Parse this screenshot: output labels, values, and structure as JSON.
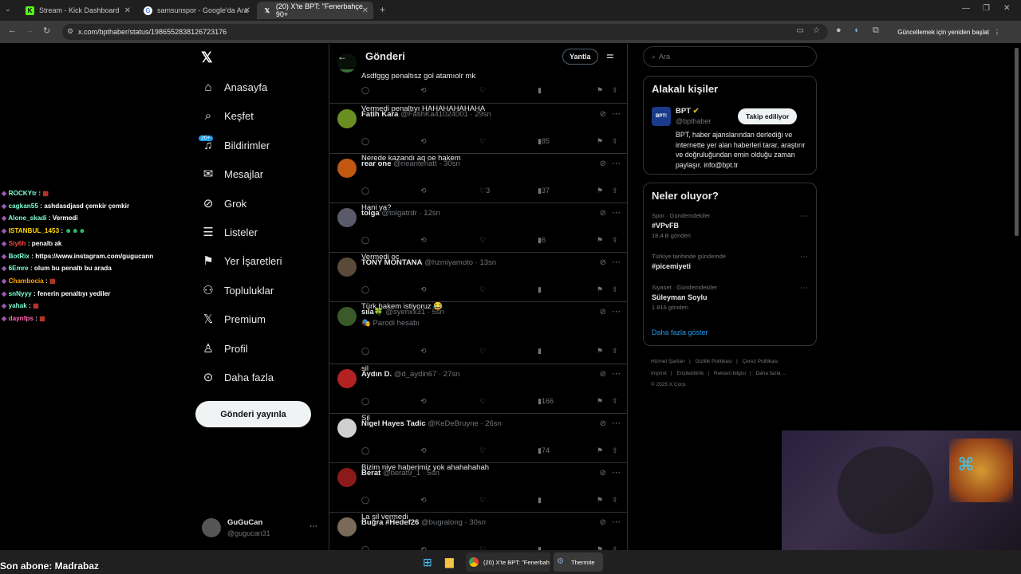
{
  "browser": {
    "tabs": [
      {
        "label": "Stream - Kick Dashboard",
        "icon": "kick-icon"
      },
      {
        "label": "samsunspor - Google'da Ara",
        "icon": "google-icon"
      },
      {
        "label": "(20) X'te BPT: \"Fenerbahçe 90+",
        "icon": "x-icon"
      }
    ],
    "url": "x.com/bpthaber/status/1986552838126723176",
    "update_button": "Güncellemek için yeniden başlat"
  },
  "nav": {
    "items": [
      {
        "label": "Anasayfa",
        "icon": "home-icon"
      },
      {
        "label": "Keşfet",
        "icon": "search-icon"
      },
      {
        "label": "Bildirimler",
        "icon": "bell-icon"
      },
      {
        "label": "Mesajlar",
        "icon": "mail-icon"
      },
      {
        "label": "Grok",
        "icon": "grok-icon"
      },
      {
        "label": "Listeler",
        "icon": "list-icon"
      },
      {
        "label": "Yer İşaretleri",
        "icon": "bookmark-icon"
      },
      {
        "label": "Topluluklar",
        "icon": "communities-icon"
      },
      {
        "label": "Premium",
        "icon": "x-icon"
      },
      {
        "label": "Profil",
        "icon": "person-icon"
      },
      {
        "label": "Daha fazla",
        "icon": "more-circle-icon"
      }
    ],
    "notif_badge": "20+",
    "post_button": "Gönderi yayınla",
    "account_name": "GuGuCan",
    "account_handle": "@gugucan31"
  },
  "main": {
    "title": "Gönderi",
    "reply_button": "Yantla",
    "tweets": [
      {
        "name": "",
        "handle": "",
        "time": "",
        "text": "Asdfggg penaltısz gol atamıolr mk",
        "likes": "",
        "views": "",
        "color": "#3a6e3a"
      },
      {
        "name": "Fatih Kara",
        "handle": "@FatihKa41024001",
        "time": "29sn",
        "text": "Vermedi penaltıyı HAHAHAHAHAHA",
        "likes": "",
        "views": "85",
        "color": "#6b8e23"
      },
      {
        "name": "rear one",
        "handle": "@neanteriatt",
        "time": "30sn",
        "text": "Nerede kazandı aq oe hakem",
        "likes": "3",
        "views": "37",
        "color": "#c2570f"
      },
      {
        "name": "tolga",
        "handle": "@tolgatrdr",
        "time": "12sn",
        "text": "Hani ya?",
        "likes": "",
        "views": "6",
        "color": "#5a5a6a"
      },
      {
        "name": "TONY MONTANA",
        "handle": "@hzmiyamoto",
        "time": "13sn",
        "text": "Vermedi oc",
        "likes": "",
        "views": "",
        "color": "#5a4a3a"
      },
      {
        "name": "sıla🍀",
        "handle": "@syenxx31",
        "time": "5sn",
        "parody": "🎭 Parodi hesabı",
        "text": "Türk hakem istiyoruz 😂",
        "likes": "",
        "views": "",
        "color": "#3a5a2a"
      },
      {
        "name": "Aydın D.",
        "handle": "@d_aydin67",
        "time": "27sn",
        "text": "sil",
        "likes": "",
        "views": "166",
        "color": "#b22222"
      },
      {
        "name": "Nigel Hayes Tadic",
        "handle": "@KeDeBruyne",
        "time": "26sn",
        "text": "Sil",
        "likes": "",
        "views": "74",
        "color": "#d0d0d0"
      },
      {
        "name": "Berat",
        "handle": "@berat9_1",
        "time": "5sn",
        "text": "Bizim niye haberimiz yok ahahahahah",
        "likes": "",
        "views": "",
        "color": "#8b1a1a"
      },
      {
        "name": "Buğra #Hedef26",
        "handle": "@bugralong",
        "time": "30sn",
        "text": "La sil vermedi",
        "likes": "",
        "views": "",
        "color": "#7a6a5a"
      }
    ]
  },
  "right": {
    "search_placeholder": "Ara",
    "related_title": "Alakalı kişiler",
    "related": {
      "name": "BPT",
      "handle": "@bpthaber",
      "follow_button": "Takip ediliyor",
      "bio": "BPT, haber ajanslarından derlediği ve internette yer alan haberleri tarar, araştırır ve doğruluğundan emin olduğu zaman paylaşır. info@bpt.tr",
      "logo": "BPT!"
    },
    "trends_title": "Neler oluyor?",
    "trends": [
      {
        "context": "Spor · Gündemdekiler",
        "topic": "#VPvFB",
        "count": "18,4 B gönderi"
      },
      {
        "context": "Türkiye tarihinde gündemde",
        "topic": "#picemiyeti",
        "count": ""
      },
      {
        "context": "Siyaset · Gündemdekiler",
        "topic": "Süleyman Soylu",
        "count": "1.816 gönderi"
      }
    ],
    "show_more": "Daha fazla göster",
    "footer": [
      "Hizmet Şartları",
      "Gizlilik Politikası",
      "Çerez Politikası",
      "Imprint",
      "Erişilebilirlik",
      "Reklam bilgisi",
      "Daha fazla ...",
      "© 2025 X Corp."
    ]
  },
  "chat": [
    {
      "user": "ROCKYtr",
      "msg": "",
      "color": "#7fffd4",
      "emote": "▦"
    },
    {
      "user": "cagkan55",
      "msg": "ashdasdjasd çemkir çemkir",
      "color": "#7fffd4",
      "emote": ""
    },
    {
      "user": "Alone_skadi",
      "msg": "Vermedi",
      "color": "#7fffd4",
      "emote": ""
    },
    {
      "user": "ISTANBUL_1453",
      "msg": "",
      "color": "#ffd700",
      "emote": "☻☻☻"
    },
    {
      "user": "Siy6h",
      "msg": "penaltı ak",
      "color": "#ff4444",
      "emote": ""
    },
    {
      "user": "BotRix",
      "msg": "https://www.instagram.com/gugucann",
      "color": "#7fffd4",
      "emote": ""
    },
    {
      "user": "6Emre",
      "msg": "olum bu penaltı bu arada",
      "color": "#7fffd4",
      "emote": ""
    },
    {
      "user": "Chambocia",
      "msg": "",
      "color": "#ffa500",
      "emote": "▦"
    },
    {
      "user": "snNyyy",
      "msg": "fenerin penaltıyı yediler",
      "color": "#7fffd4",
      "emote": ""
    },
    {
      "user": "yahak",
      "msg": "",
      "color": "#7fffd4",
      "emote": "▦"
    },
    {
      "user": "daynfps",
      "msg": "",
      "color": "#ff69b4",
      "emote": "▦"
    }
  ],
  "overlay": {
    "last_sub": "Son abone: Madrabaz"
  },
  "taskbar": {
    "items": [
      {
        "label": "(20) X'te BPT: \"Fenerbah"
      },
      {
        "label": "Thermite"
      }
    ]
  }
}
